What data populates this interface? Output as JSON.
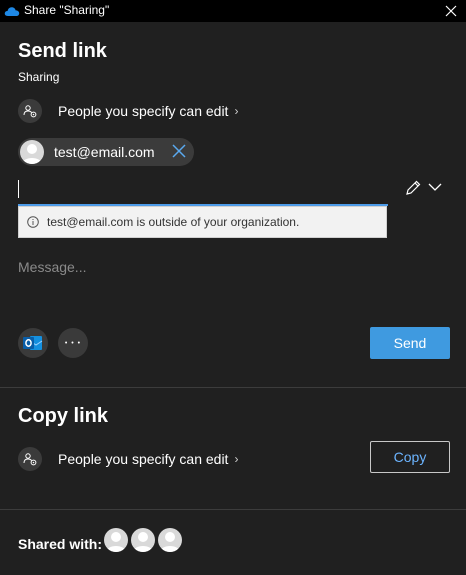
{
  "window": {
    "title": "Share \"Sharing\""
  },
  "send_section": {
    "heading": "Send link",
    "item_name": "Sharing",
    "permission": "People you specify can edit",
    "permission_chevron": "›",
    "recipient_email": "test@email.com",
    "warning": "test@email.com is outside of your organization.",
    "message_placeholder": "Message...",
    "more_glyph": "• • •",
    "send_label": "Send"
  },
  "copy_section": {
    "heading": "Copy link",
    "permission": "People you specify can edit",
    "permission_chevron": "›",
    "copy_label": "Copy"
  },
  "shared": {
    "label": "Shared with:",
    "avatars": [
      "user",
      "user",
      "user"
    ]
  },
  "colors": {
    "accent": "#3f9ae0",
    "link": "#6cb4ff",
    "panel": "#202020",
    "titlebar": "#000000"
  }
}
